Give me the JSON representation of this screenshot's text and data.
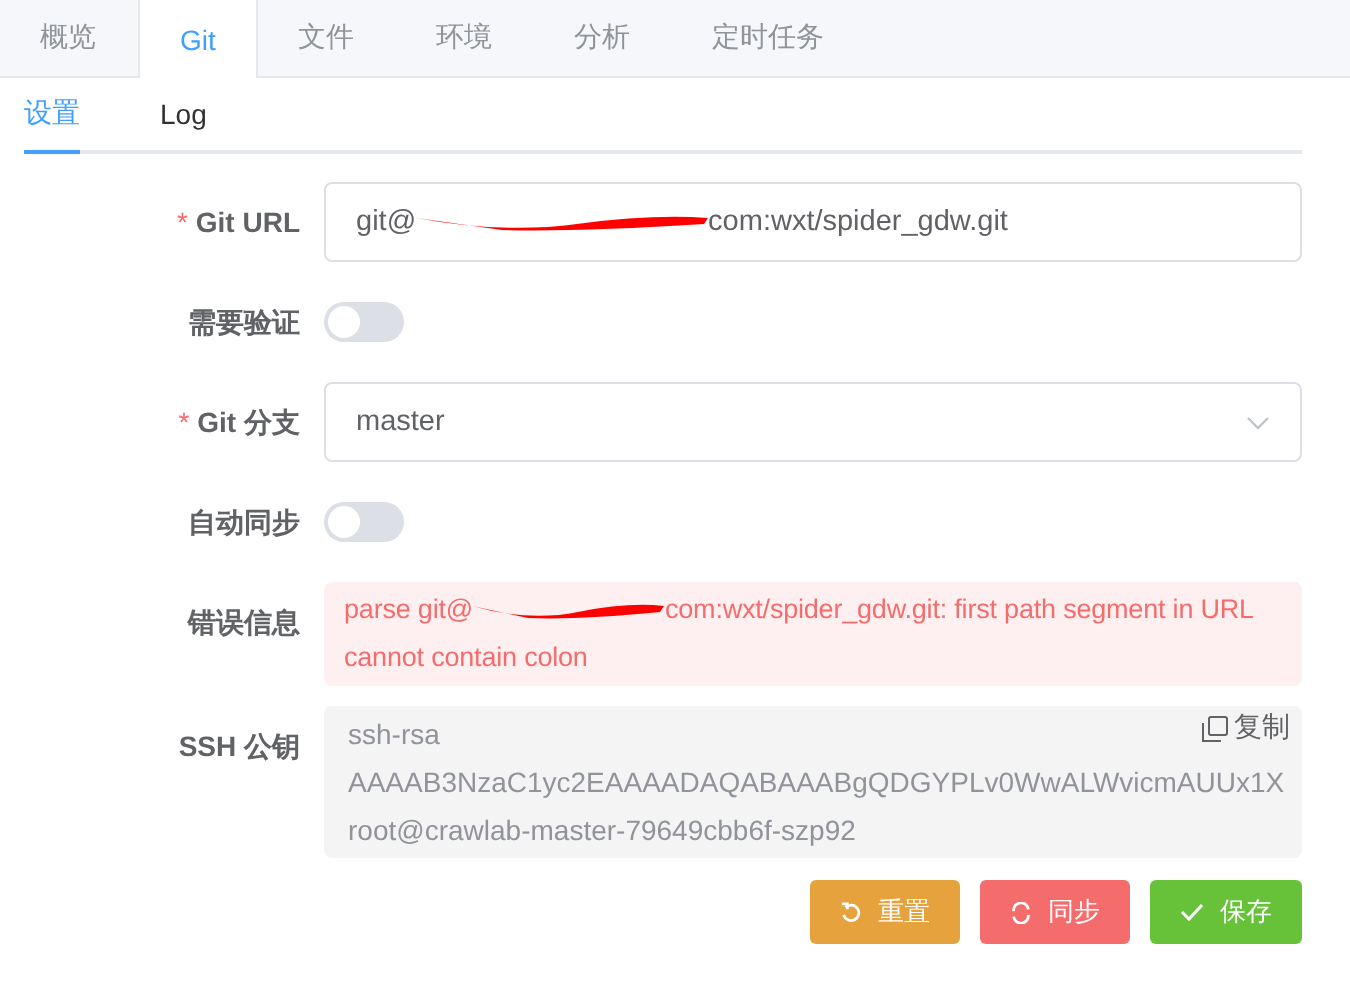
{
  "tabs": [
    {
      "label": "概览",
      "selected": false
    },
    {
      "label": "Git",
      "selected": true
    },
    {
      "label": "文件",
      "selected": false
    },
    {
      "label": "环境",
      "selected": false
    },
    {
      "label": "分析",
      "selected": false
    },
    {
      "label": "定时任务",
      "selected": false
    }
  ],
  "subtabs": [
    {
      "label": "设置",
      "selected": true
    },
    {
      "label": "Log",
      "selected": false
    }
  ],
  "form": [
    {
      "kind": "input",
      "label": "Git URL",
      "required_mark": "*",
      "parts": [
        {
          "kind": "text",
          "text": "git@"
        },
        {
          "kind": "redaction"
        },
        {
          "kind": "text",
          "text": "com:wxt/spider_gdw.git"
        }
      ]
    },
    {
      "kind": "switch",
      "label": "需要验证",
      "on": false
    },
    {
      "kind": "select",
      "label": "Git 分支",
      "required_mark": "*",
      "value": "master"
    },
    {
      "kind": "switch",
      "label": "自动同步",
      "on": false
    },
    {
      "kind": "error",
      "label": "错误信息",
      "parts": [
        {
          "kind": "text",
          "text": "parse git@"
        },
        {
          "kind": "redaction"
        },
        {
          "kind": "text",
          "text": "com:wxt/spider_gdw.git: first path segment in URL cannot contain colon"
        }
      ]
    },
    {
      "kind": "key",
      "label": "SSH 公钥",
      "lines": [
        "ssh-rsa",
        "AAAAB3NzaC1yc2EAAAADAQABAAABgQDGYPLv0WwALWvicmAUUx1X",
        "root@crawlab-master-79649cbb6f-szp92"
      ],
      "copy_label": "复制"
    }
  ],
  "buttons": [
    {
      "label": "重置",
      "kind": "reset"
    },
    {
      "label": "同步",
      "kind": "sync"
    },
    {
      "label": "保存",
      "kind": "save"
    }
  ]
}
